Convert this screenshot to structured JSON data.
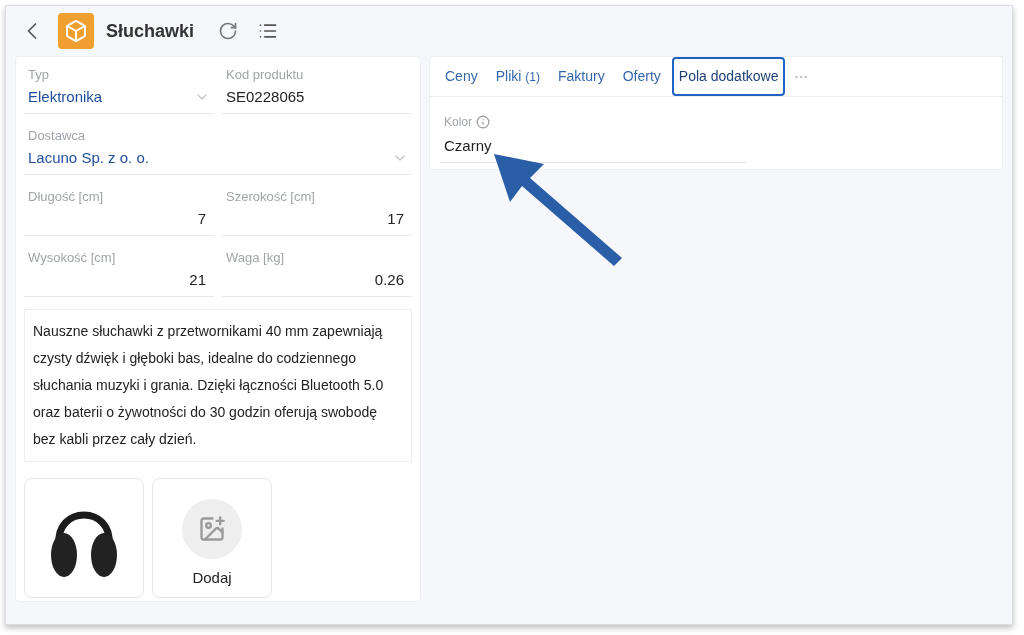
{
  "header": {
    "title": "Słuchawki"
  },
  "fields": [
    {
      "label": "Typ",
      "value": "Elektronika",
      "kind": "select"
    },
    {
      "label": "Kod produktu",
      "value": "SE0228065",
      "kind": "text"
    },
    {
      "label": "Dostawca",
      "value": "Lacuno Sp. z o. o.",
      "kind": "select"
    },
    {
      "label": "Długość [cm]",
      "value": "7",
      "kind": "number"
    },
    {
      "label": "Szerokość [cm]",
      "value": "17",
      "kind": "number"
    },
    {
      "label": "Wysokość [cm]",
      "value": "21",
      "kind": "number"
    },
    {
      "label": "Waga [kg]",
      "value": "0.26",
      "kind": "number"
    }
  ],
  "description": "Nauszne słuchawki z przetwornikami 40 mm zapewniają czysty dźwięk i głęboki bas, idealne do codziennego słuchania muzyki i grania. Dzięki łączności Bluetooth 5.0 oraz baterii o żywotności do 30 godzin oferują swobodę bez kabli przez cały dzień.",
  "images": [
    {
      "kind": "photo"
    },
    {
      "kind": "add",
      "label": "Dodaj"
    }
  ],
  "tabs": [
    {
      "label": "Ceny",
      "selected": false
    },
    {
      "label": "Pliki",
      "count": "(1)",
      "selected": false
    },
    {
      "label": "Faktury",
      "selected": false
    },
    {
      "label": "Oferty",
      "selected": false
    },
    {
      "label": "Pola dodatkowe",
      "selected": true
    }
  ],
  "custom_fields": [
    {
      "label": "Kolor",
      "value": "Czarny"
    }
  ]
}
